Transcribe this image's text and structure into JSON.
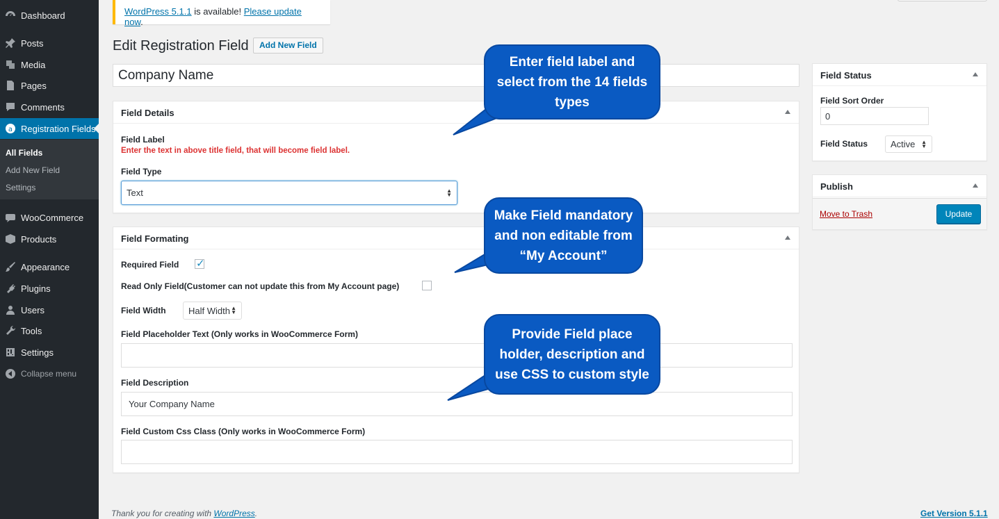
{
  "sidebar": {
    "items": [
      {
        "label": "Dashboard",
        "icon": "dashboard-icon"
      },
      {
        "label": "Posts",
        "icon": "pin-icon"
      },
      {
        "label": "Media",
        "icon": "media-icon"
      },
      {
        "label": "Pages",
        "icon": "pages-icon"
      },
      {
        "label": "Comments",
        "icon": "comment-icon"
      },
      {
        "label": "Registration Fields",
        "icon": "registration-icon"
      },
      {
        "label": "WooCommerce",
        "icon": "woocommerce-icon"
      },
      {
        "label": "Products",
        "icon": "products-icon"
      },
      {
        "label": "Appearance",
        "icon": "brush-icon"
      },
      {
        "label": "Plugins",
        "icon": "plugin-icon"
      },
      {
        "label": "Users",
        "icon": "users-icon"
      },
      {
        "label": "Tools",
        "icon": "wrench-icon"
      },
      {
        "label": "Settings",
        "icon": "settings-icon"
      }
    ],
    "submenu": [
      "All Fields",
      "Add New Field",
      "Settings"
    ],
    "collapse_label": "Collapse menu"
  },
  "notice": {
    "version_link": "WordPress 5.1.1",
    "middle": " is available! ",
    "update_link": "Please update now",
    "end": "."
  },
  "page": {
    "title": "Edit Registration Field",
    "add_new_label": "Add New Field",
    "title_value": "Company Name"
  },
  "field_details": {
    "heading": "Field Details",
    "label_title": "Field Label",
    "label_error": "Enter the text in above title field, that will become field label.",
    "type_title": "Field Type",
    "type_value": "Text"
  },
  "field_formatting": {
    "heading": "Field Formating",
    "required_label": "Required Field",
    "required_checked": true,
    "readonly_label": "Read Only Field(Customer can not update this from My Account page)",
    "readonly_checked": false,
    "width_label": "Field Width",
    "width_value": "Half Width",
    "placeholder_label": "Field Placeholder Text (Only works in WooCommerce Form)",
    "placeholder_value": "",
    "description_label": "Field Description",
    "description_value": "Your Company Name",
    "css_label": "Field Custom Css Class (Only works in WooCommerce Form)",
    "css_value": ""
  },
  "field_status": {
    "heading": "Field Status",
    "sort_label": "Field Sort Order",
    "sort_value": "0",
    "status_label": "Field Status",
    "status_value": "Active"
  },
  "publish": {
    "heading": "Publish",
    "trash_label": "Move to Trash",
    "update_label": "Update"
  },
  "callouts": {
    "one": [
      "Enter field label and",
      "select from the 14 fields",
      "types"
    ],
    "two": [
      "Make Field mandatory",
      "and non editable from",
      "“My Account”"
    ],
    "three": [
      "Provide Field place",
      "holder, description and",
      "use CSS to custom style"
    ]
  },
  "footer": {
    "thanks_prefix": "Thank you for creating with ",
    "thanks_link": "WordPress",
    "thanks_suffix": ".",
    "version": "Get Version 5.1.1"
  },
  "colors": {
    "sidebar_bg": "#23282d",
    "active_menu": "#0073aa",
    "callout_blue": "#0a5ac2",
    "error_red": "#dc3232",
    "primary_button": "#0085ba"
  }
}
